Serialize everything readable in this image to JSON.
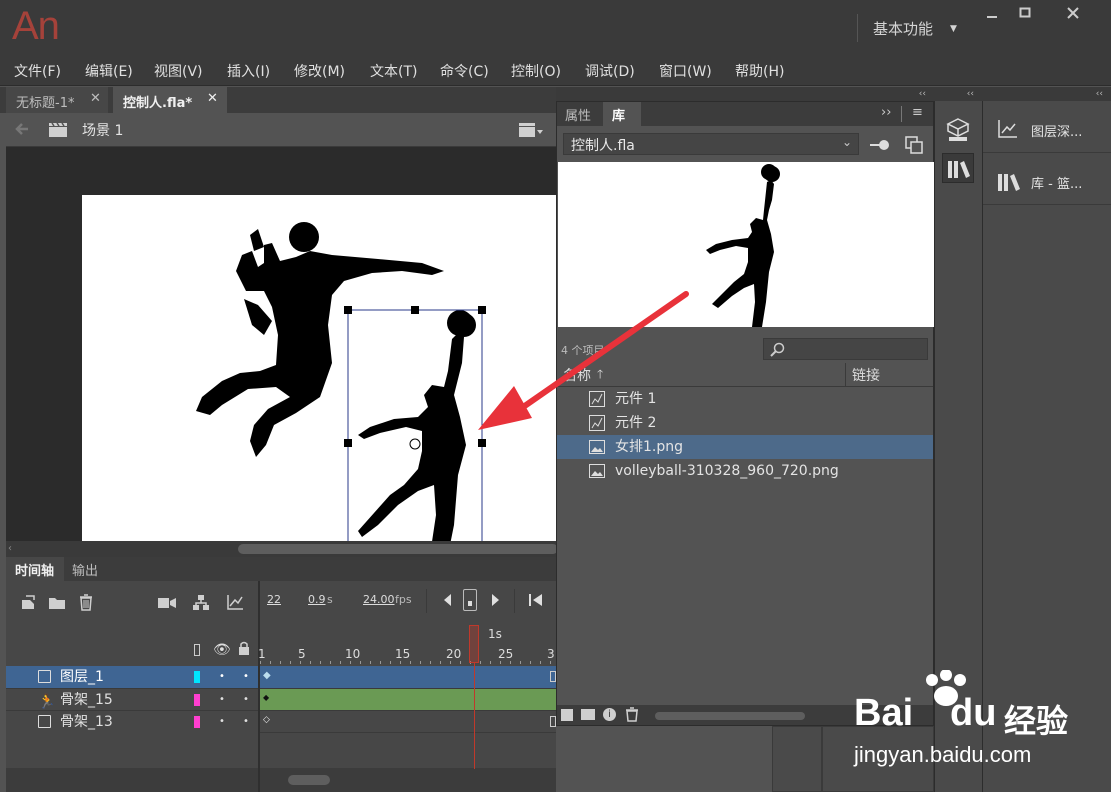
{
  "app": {
    "logo": "An",
    "workspace": "基本功能"
  },
  "menu": [
    "文件(F)",
    "编辑(E)",
    "视图(V)",
    "插入(I)",
    "修改(M)",
    "文本(T)",
    "命令(C)",
    "控制(O)",
    "调试(D)",
    "窗口(W)",
    "帮助(H)"
  ],
  "tabs": [
    {
      "label": "无标题-1*"
    },
    {
      "label": "控制人.fla*"
    }
  ],
  "scene": {
    "label": "场景 1"
  },
  "timeline": {
    "tabs": [
      "时间轴",
      "输出"
    ],
    "frame": "22",
    "time": "0.9",
    "time_unit": "s",
    "fps": "24.00",
    "fps_unit": "fps",
    "second_marker": "1s",
    "ruler": [
      "1",
      "5",
      "10",
      "15",
      "20",
      "25",
      "3"
    ],
    "layers": [
      {
        "name": "图层_1",
        "color": "#00e5ff"
      },
      {
        "name": "骨架_15",
        "color": "#ff3fd0"
      },
      {
        "name": "骨架_13",
        "color": "#ff3fd0"
      }
    ]
  },
  "library": {
    "tab_props": "属性",
    "tab_lib": "库",
    "file": "控制人.fla",
    "count": "4 个项目",
    "col_name": "名称",
    "col_link": "链接",
    "items": [
      {
        "name": "元件 1",
        "icon": "movieclip-icon"
      },
      {
        "name": "元件 2",
        "icon": "movieclip-icon"
      },
      {
        "name": "女排1.png",
        "icon": "bitmap-icon",
        "selected": true
      },
      {
        "name": "volleyball-310328_960_720.png",
        "icon": "bitmap-icon"
      }
    ]
  },
  "dock2": [
    {
      "label": "图层深..."
    },
    {
      "label": "库 - 篮..."
    }
  ],
  "watermark": {
    "brand1": "Bai",
    "brand2": "du",
    "cn": "经验",
    "url": "jingyan.baidu.com"
  },
  "colors": {
    "arrow": "#e8323a",
    "selected_row": "#3d5a80",
    "layer_selected": "#3f6593",
    "armature_span": "#6a9a54",
    "playhead": "#c0392b"
  }
}
